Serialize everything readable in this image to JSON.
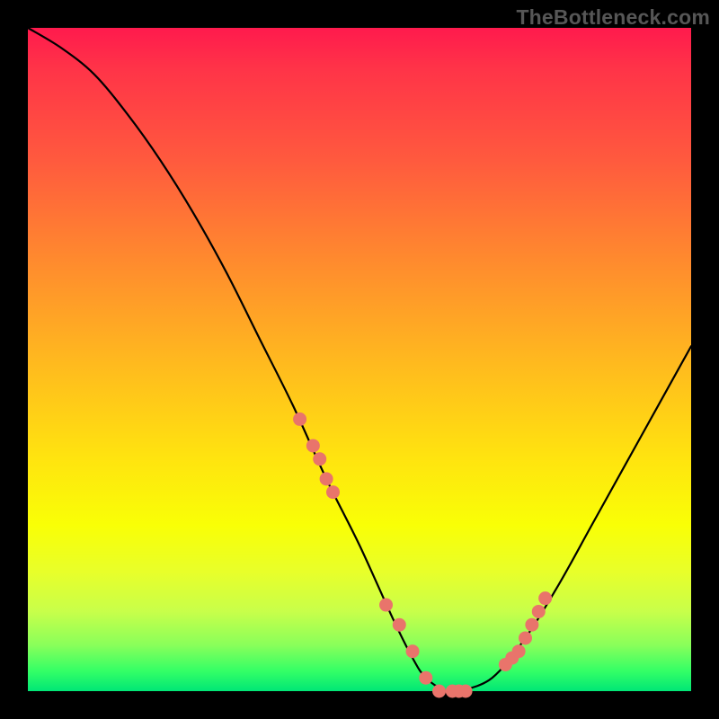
{
  "watermark": "TheBottleneck.com",
  "chart_data": {
    "type": "line",
    "title": "",
    "xlabel": "",
    "ylabel": "",
    "xlim": [
      0,
      100
    ],
    "ylim": [
      0,
      100
    ],
    "series": [
      {
        "name": "bottleneck-curve",
        "x": [
          0,
          5,
          10,
          15,
          20,
          25,
          30,
          35,
          40,
          45,
          50,
          55,
          58,
          60,
          63,
          65,
          70,
          75,
          80,
          85,
          90,
          95,
          100
        ],
        "values": [
          100,
          97,
          93,
          87,
          80,
          72,
          63,
          53,
          43,
          32,
          22,
          11,
          5,
          2,
          0,
          0,
          2,
          8,
          16,
          25,
          34,
          43,
          52
        ]
      }
    ],
    "markers": {
      "name": "highlight-dots",
      "color": "#e9746b",
      "x": [
        41,
        43,
        44,
        45,
        46,
        54,
        56,
        58,
        60,
        62,
        64,
        65,
        66,
        72,
        73,
        74,
        75,
        76,
        77,
        78
      ],
      "values": [
        41,
        37,
        35,
        32,
        30,
        13,
        10,
        6,
        2,
        0,
        0,
        0,
        0,
        4,
        5,
        6,
        8,
        10,
        12,
        14
      ]
    },
    "gradient_stops": [
      {
        "pos": 0.0,
        "color": "#ff1a4d"
      },
      {
        "pos": 0.5,
        "color": "#ffe40f"
      },
      {
        "pos": 0.82,
        "color": "#e8ff2a"
      },
      {
        "pos": 1.0,
        "color": "#00e676"
      }
    ]
  }
}
